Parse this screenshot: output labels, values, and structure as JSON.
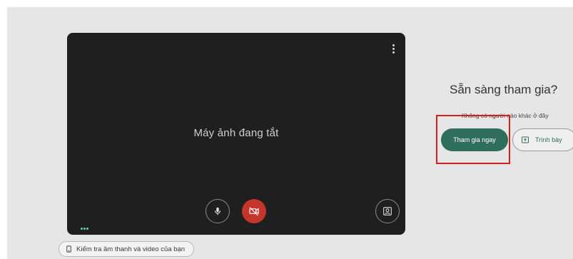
{
  "preview": {
    "camera_status": "Máy ảnh đang tắt",
    "more_options_icon": "more-vert-icon",
    "controls": {
      "mic_icon": "microphone-icon",
      "camera_icon": "camera-off-icon",
      "effects_icon": "visual-effects-icon"
    }
  },
  "check_audio_video": {
    "label": "Kiểm tra âm thanh và video của bạn",
    "icon": "device-check-icon"
  },
  "join_panel": {
    "title": "Sẵn sàng tham gia?",
    "subtitle": "Không có người nào khác ở đây",
    "join_label": "Tham gia ngay",
    "present_label": "Trình bày",
    "present_icon": "present-screen-icon"
  },
  "colors": {
    "accent": "#2f6e5c",
    "camera_off": "#c4352c",
    "highlight": "#d3201f"
  }
}
